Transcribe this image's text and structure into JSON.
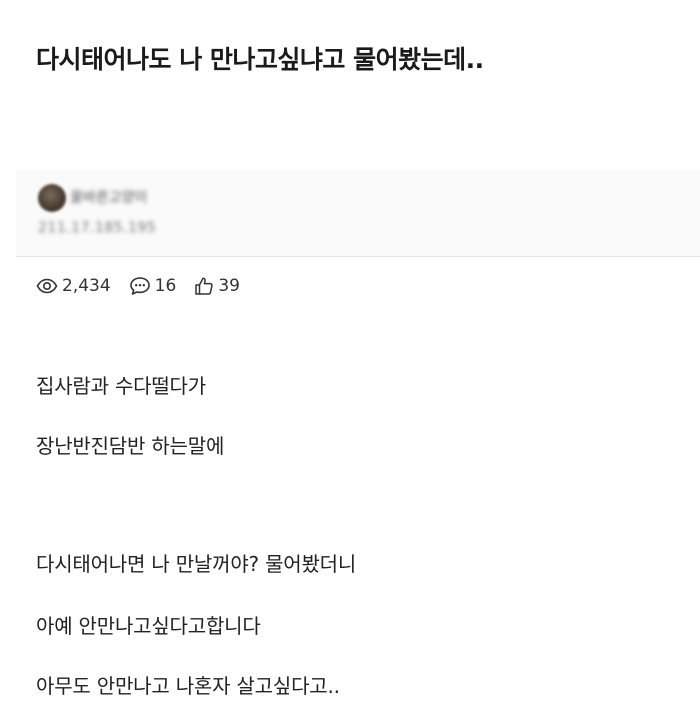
{
  "post": {
    "title": "다시태어나도 나 만나고싶냐고 물어봤는데..",
    "author": {
      "name": "꿀바른고양이",
      "ip": "211.17.185.195"
    },
    "stats": {
      "views": "2,434",
      "comments": "16",
      "likes": "39"
    },
    "body": [
      "집사람과 수다떨다가",
      "장난반진담반 하는말에",
      "다시태어나면 나 만날꺼야? 물어봤더니",
      "아예 안만나고싶다고합니다",
      "아무도 안만나고 나혼자 살고싶다고.."
    ]
  }
}
